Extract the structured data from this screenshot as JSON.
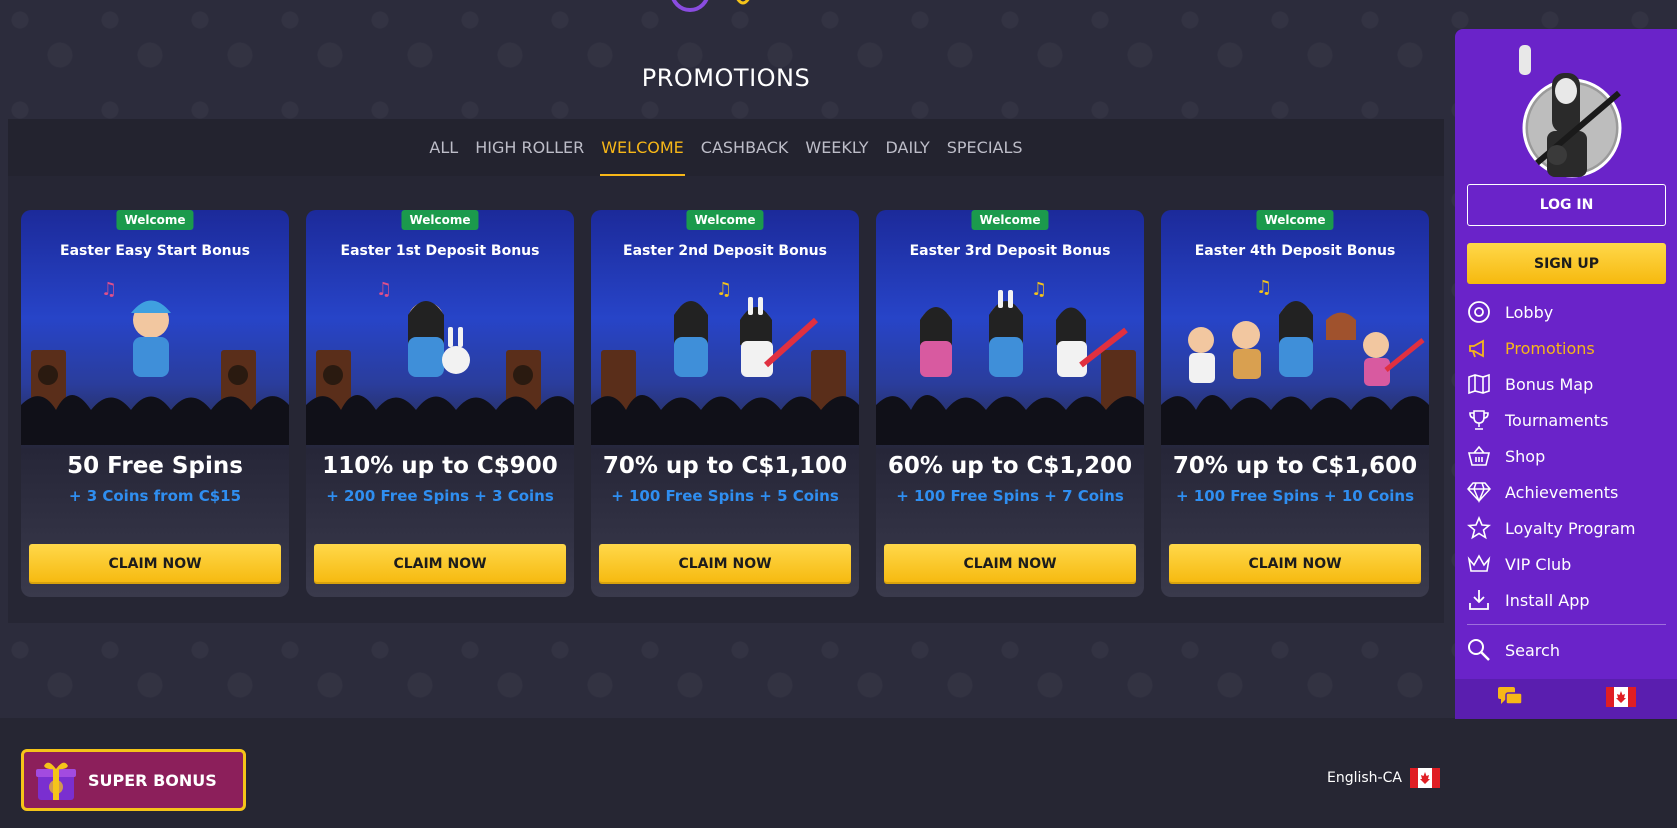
{
  "header": {
    "title": "PROMOTIONS"
  },
  "tabs": [
    {
      "label": "ALL"
    },
    {
      "label": "HIGH ROLLER"
    },
    {
      "label": "WELCOME"
    },
    {
      "label": "CASHBACK"
    },
    {
      "label": "WEEKLY"
    },
    {
      "label": "DAILY"
    },
    {
      "label": "SPECIALS"
    }
  ],
  "active_tab": "WELCOME",
  "cards": [
    {
      "badge": "Welcome",
      "title": "Easter Easy Start Bonus",
      "main": "50 Free Spins",
      "sub": "+ 3 Coins from C$15",
      "cta": "CLAIM NOW"
    },
    {
      "badge": "Welcome",
      "title": "Easter 1st Deposit Bonus",
      "main": "110% up to C$900",
      "sub": "+ 200 Free Spins + 3 Coins",
      "cta": "CLAIM NOW"
    },
    {
      "badge": "Welcome",
      "title": "Easter 2nd Deposit Bonus",
      "main": "70% up to C$1,100",
      "sub": "+ 100 Free Spins + 5 Coins",
      "cta": "CLAIM NOW"
    },
    {
      "badge": "Welcome",
      "title": "Easter 3rd Deposit Bonus",
      "main": "60% up to C$1,200",
      "sub": "+ 100 Free Spins + 7 Coins",
      "cta": "CLAIM NOW"
    },
    {
      "badge": "Welcome",
      "title": "Easter 4th Deposit Bonus",
      "main": "70% up to C$1,600",
      "sub": "+ 100 Free Spins + 10 Coins",
      "cta": "CLAIM NOW"
    }
  ],
  "sidebar": {
    "login_label": "LOG IN",
    "signup_label": "SIGN UP",
    "items": [
      {
        "label": "Lobby",
        "icon": "lobby-icon"
      },
      {
        "label": "Promotions",
        "icon": "megaphone-icon"
      },
      {
        "label": "Bonus Map",
        "icon": "map-icon"
      },
      {
        "label": "Tournaments",
        "icon": "trophy-icon"
      },
      {
        "label": "Shop",
        "icon": "basket-icon"
      },
      {
        "label": "Achievements",
        "icon": "diamond-icon"
      },
      {
        "label": "Loyalty Program",
        "icon": "star-icon"
      },
      {
        "label": "VIP Club",
        "icon": "crown-icon"
      },
      {
        "label": "Install App",
        "icon": "download-icon"
      }
    ],
    "search_label": "Search"
  },
  "footer": {
    "super_bonus_label": "SUPER BONUS",
    "language_label": "English-CA"
  },
  "colors": {
    "accent": "#f7b718",
    "sidebar": "#6a23c9",
    "badge": "#1b9a4c",
    "sub_text": "#2f8ef0"
  }
}
